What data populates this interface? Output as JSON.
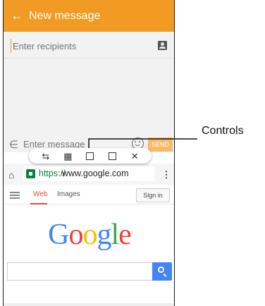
{
  "messaging": {
    "title": "New message",
    "recipients_placeholder": "Enter recipients",
    "message_placeholder": "Enter message",
    "send_label": "SEND",
    "header_color": "#f29b24"
  },
  "controls": {
    "icons": [
      "switch-windows-icon",
      "drag-and-drop-icon",
      "minimize-window-icon",
      "maximize-window-icon",
      "close-icon"
    ]
  },
  "browser": {
    "url_scheme": "https://",
    "url_rest": "www.google.com",
    "nav_web": "Web",
    "nav_images": "Images",
    "sign_in": "Sign in",
    "logo_letters": [
      {
        "ch": "G",
        "color": "#4285f4"
      },
      {
        "ch": "o",
        "color": "#ea4335"
      },
      {
        "ch": "o",
        "color": "#fbbc05"
      },
      {
        "ch": "g",
        "color": "#4285f4"
      },
      {
        "ch": "l",
        "color": "#34a853"
      },
      {
        "ch": "e",
        "color": "#ea4335"
      }
    ]
  },
  "callout": {
    "label": "Controls"
  }
}
